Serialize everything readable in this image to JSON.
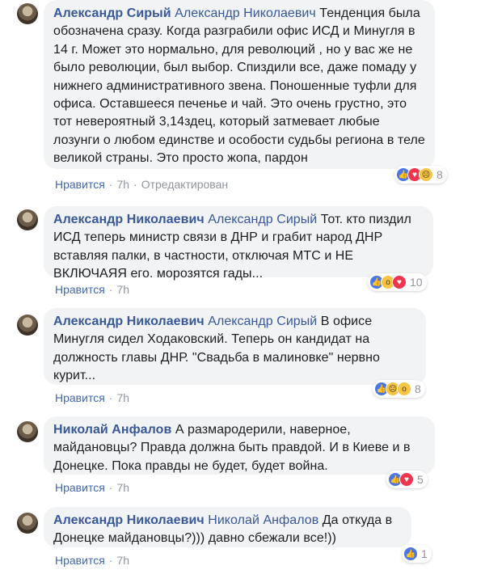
{
  "reactions_label": "Нравится",
  "comments": [
    {
      "author": "Александр Сирый",
      "mention": "Александр Николаевич",
      "text": "Тенденция была обозначена сразу. Когда разграбили офис ИСД и Минугля в 14 г. Может это нормально, для революций , но у вас же не было революции, был выбор. Спиздили все, даже помаду у нижнего административного звена. Поношенные туфли для офиса. Оставшееся печенье и чай. Это очень грустно, это тот невероятный 3,14здец, который затмевает любые лозунги о любом единстве и особости судьбы региона в теле великой страны. Это просто жопа, пардон",
      "time": "7h",
      "edited": "Отредактирован",
      "reaction_count": "8",
      "reaction_icons": [
        "like-icon",
        "love-icon",
        "sad-icon"
      ]
    },
    {
      "author": "Александр Николаевич",
      "mention": "Александр Сирый",
      "text": "Тот. кто пиздил ИСД теперь министр связи в ДНР и грабит народ ДНР вставляя палки, в частности, отключая МТС и НЕ ВКЛЮЧАЯЯ его. морозятся гады...",
      "time": "7h",
      "reaction_count": "10",
      "reaction_icons": [
        "like-icon",
        "wow-icon",
        "love-icon"
      ]
    },
    {
      "author": "Александр Николаевич",
      "mention": "Александр Сирый",
      "text": "В офисе Минугля сидел Ходаковский. Теперь он кандидат на должность главы ДНР. \"Свадьба в малиновке\" нервно курит...",
      "time": "7h",
      "reaction_count": "8",
      "reaction_icons": [
        "like-icon",
        "sad-icon",
        "wow-icon"
      ]
    },
    {
      "author": "Николай Анфалов",
      "mention": "",
      "text": "А размародерили, наверное, майдановцы? Правда должна быть правдой. И в Киеве и в Донецке. Пока правды не будет, будет война.",
      "time": "7h",
      "reaction_count": "5",
      "reaction_icons": [
        "like-icon",
        "love-icon"
      ]
    },
    {
      "author": "Александр Николаевич",
      "mention": "Николай Анфалов",
      "text": "Да откуда в Донецке майдановцы?))) давно сбежали все!))",
      "time": "7h",
      "reaction_count": "1",
      "reaction_icons": [
        "like-icon"
      ]
    }
  ]
}
